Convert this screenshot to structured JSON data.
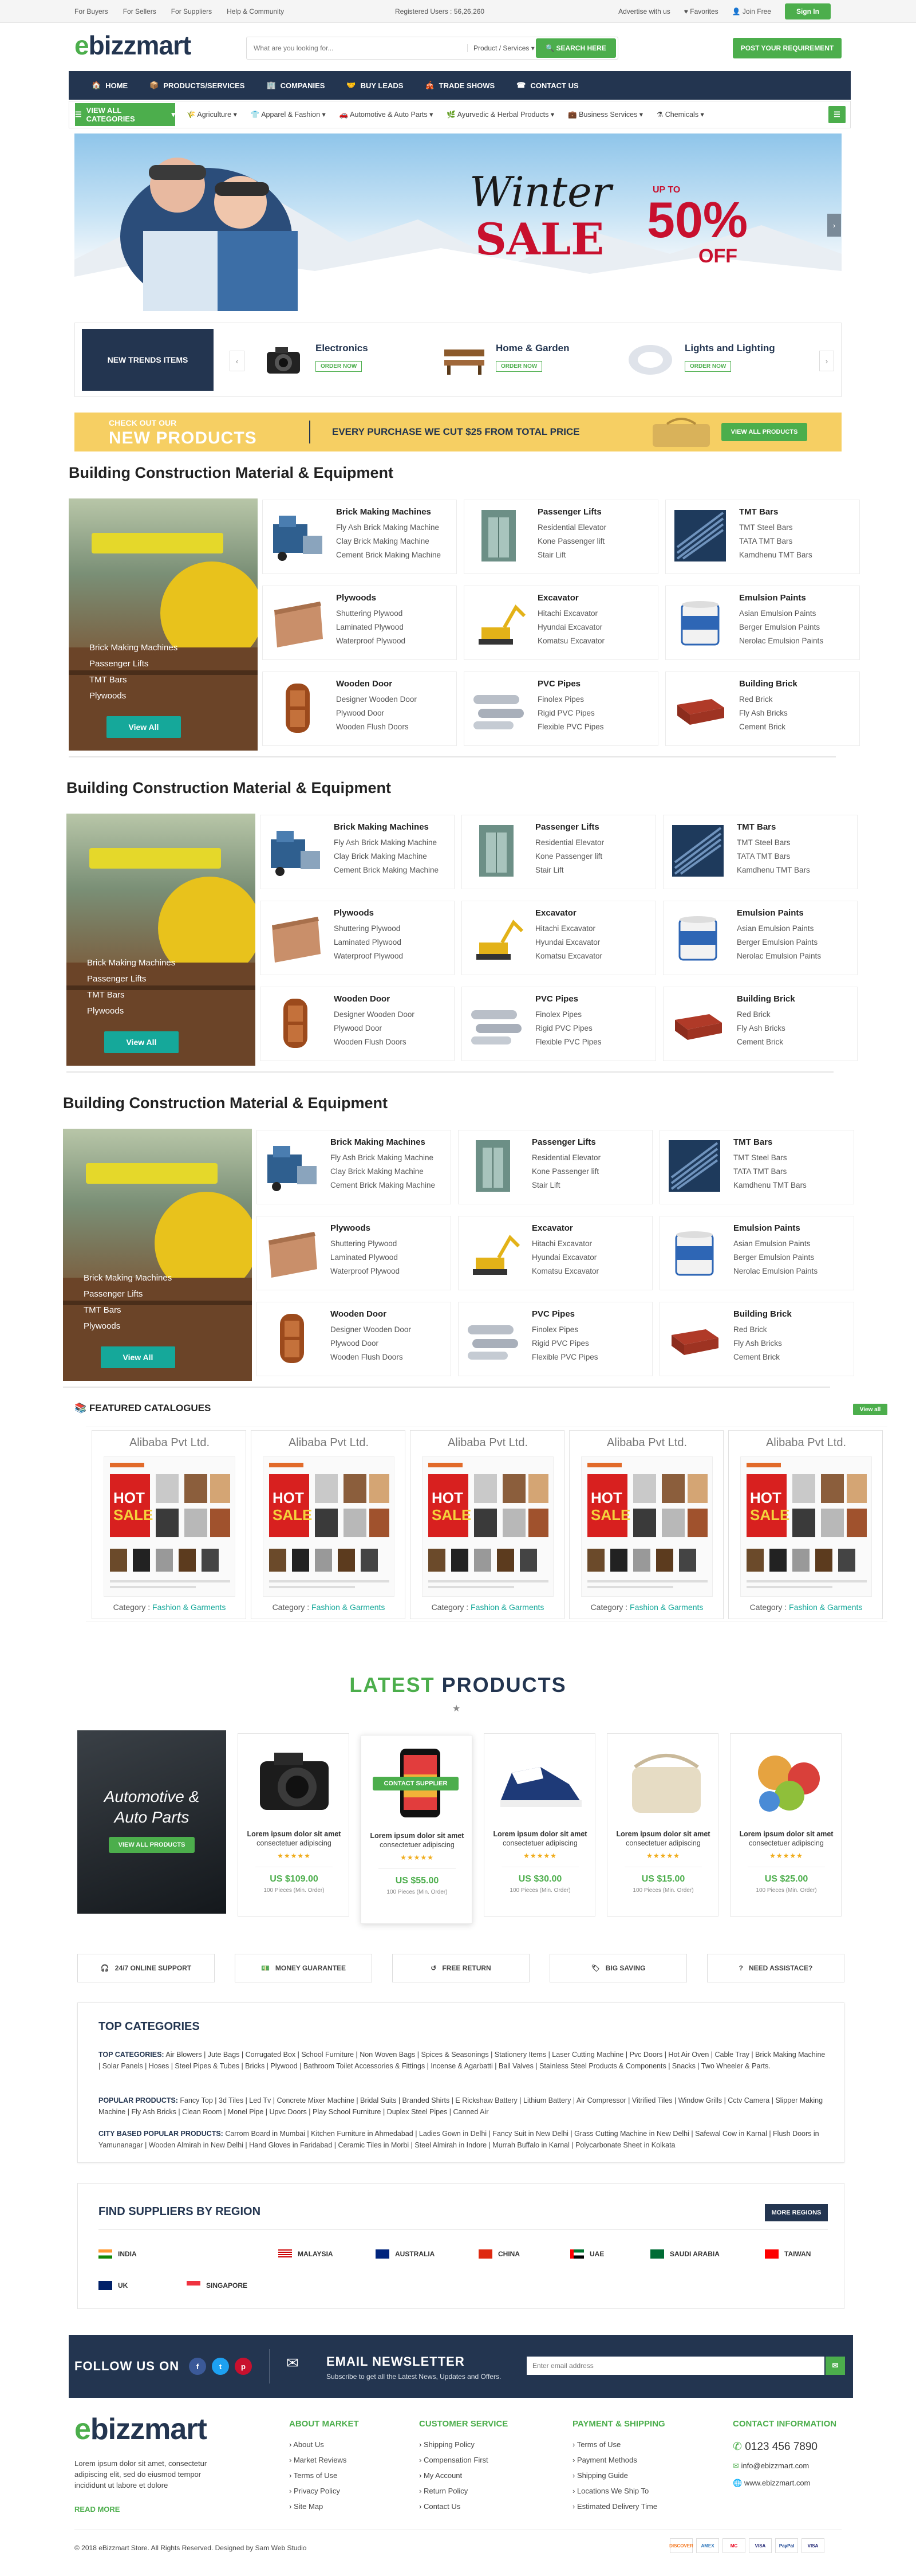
{
  "topbar": {
    "links": [
      "For Buyers",
      "For Sellers",
      "For Suppliers",
      "Help & Community"
    ],
    "registered": "Registered Users : 56,26,260",
    "advertise": "Advertise with us",
    "favorites": "Favorites",
    "join": "Join Free",
    "signin": "Sign In"
  },
  "brand": {
    "logo_e": "e",
    "logo_rest": "bizzmart"
  },
  "search": {
    "placeholder": "What are you looking for...",
    "select": "Product / Services",
    "button": "SEARCH HERE",
    "post": "POST YOUR REQUIREMENT"
  },
  "nav": [
    {
      "label": "HOME"
    },
    {
      "label": "PRODUCTS/SERVICES"
    },
    {
      "label": "COMPANIES"
    },
    {
      "label": "BUY LEADS"
    },
    {
      "label": "TRADE SHOWS"
    },
    {
      "label": "CONTACT US"
    }
  ],
  "categories": {
    "all": "VIEW ALL CATEGORIES",
    "items": [
      "Agriculture",
      "Apparel & Fashion",
      "Automotive & Auto Parts",
      "Ayurvedic & Herbal Products",
      "Business Services",
      "Chemicals"
    ]
  },
  "hero": {
    "winter": "Winter",
    "sale": "SALE",
    "upto": "UP TO",
    "pct": "50%",
    "off": "OFF"
  },
  "trends": {
    "label": "NEW TRENDS ITEMS",
    "items": [
      {
        "name": "Electronics",
        "btn": "ORDER NOW"
      },
      {
        "name": "Home & Garden",
        "btn": "ORDER NOW"
      },
      {
        "name": "Lights and Lighting",
        "btn": "ORDER NOW"
      }
    ]
  },
  "promo": {
    "small": "CHECK OUT OUR",
    "big": "NEW PRODUCTS",
    "mid": "EVERY PURCHASE WE CUT $25 FROM TOTAL PRICE",
    "btn": "VIEW ALL PRODUCTS"
  },
  "construction": {
    "title": "Building Construction Material & Equipment",
    "banner_items": [
      "Brick Making Machines",
      "Passenger Lifts",
      "TMT Bars",
      "Plywoods"
    ],
    "view_all": "View All",
    "cards": [
      {
        "title": "Brick Making Machines",
        "subs": [
          "Fly Ash Brick Making Machine",
          "Clay Brick Making Machine",
          "Cement Brick Making Machine"
        ]
      },
      {
        "title": "Passenger Lifts",
        "subs": [
          "Residential Elevator",
          "Kone Passenger lift",
          "Stair Lift"
        ]
      },
      {
        "title": "TMT Bars",
        "subs": [
          "TMT Steel Bars",
          "TATA TMT Bars",
          "Kamdhenu TMT Bars"
        ]
      },
      {
        "title": "Plywoods",
        "subs": [
          "Shuttering Plywood",
          "Laminated Plywood",
          "Waterproof Plywood"
        ]
      },
      {
        "title": "Excavator",
        "subs": [
          "Hitachi Excavator",
          "Hyundai Excavator",
          "Komatsu Excavator"
        ]
      },
      {
        "title": "Emulsion Paints",
        "subs": [
          "Asian Emulsion Paints",
          "Berger Emulsion Paints",
          "Nerolac Emulsion Paints"
        ]
      },
      {
        "title": "Wooden Door",
        "subs": [
          "Designer Wooden Door",
          "Plywood Door",
          "Wooden Flush Doors"
        ]
      },
      {
        "title": "PVC Pipes",
        "subs": [
          "Finolex Pipes",
          "Rigid PVC Pipes",
          "Flexible PVC Pipes"
        ]
      },
      {
        "title": "Building Brick",
        "subs": [
          "Red Brick",
          "Fly Ash Bricks",
          "Cement Brick"
        ]
      }
    ]
  },
  "catalogues": {
    "title": "FEATURED CATALOGUES",
    "view_all": "View all",
    "company": "Alibaba Pvt Ltd.",
    "category_label": "Category :",
    "category": "Fashion & Garments"
  },
  "latest": {
    "title_a": "LATEST",
    "title_b": "PRODUCTS",
    "banner_line1": "Automotive &",
    "banner_line2": "Auto Parts",
    "banner_btn": "VIEW ALL PRODUCTS",
    "desc1": "Lorem ipsum dolor sit amet",
    "desc2": "consectetuer adipiscing",
    "contact": "CONTACT SUPPLIER",
    "min": "100 Pieces (Min. Order)",
    "prices": [
      "US $109.00",
      "US $55.00",
      "US $30.00",
      "US $15.00",
      "US $25.00"
    ]
  },
  "services": [
    "24/7 ONLINE SUPPORT",
    "MONEY GUARANTEE",
    "FREE RETURN",
    "BIG SAVING",
    "NEED ASSISTACE?"
  ],
  "top_categories": {
    "title": "TOP CATEGORIES",
    "rows": [
      {
        "label": "TOP CATEGORIES:",
        "text": "Air Blowers | Jute Bags | Corrugated Box | School Furniture | Non Woven Bags | Spices & Seasonings | Stationery Items | Laser Cutting Machine | Pvc Doors | Hot Air Oven | Cable Tray | Brick Making Machine | Solar Panels | Hoses | Steel Pipes & Tubes | Bricks | Plywood | Bathroom Toilet Accessories & Fittings | Incense & Agarbatti | Ball Valves | Stainless Steel Products & Components | Snacks | Two Wheeler & Parts."
      },
      {
        "label": "POPULAR PRODUCTS:",
        "text": "Fancy Top | 3d Tiles | Led Tv | Concrete Mixer Machine | Bridal Suits | Branded Shirts | E Rickshaw Battery | Lithium Battery | Air Compressor | Vitrified Tiles | Window Grills | Cctv Camera | Slipper Making Machine | Fly Ash Bricks | Clean Room | Monel Pipe | Upvc Doors | Play School Furniture | Duplex Steel Pipes | Canned Air"
      },
      {
        "label": "CITY BASED POPULAR PRODUCTS:",
        "text": "Carrom Board in Mumbai | Kitchen Furniture in Ahmedabad | Ladies Gown in Delhi | Fancy Suit in New Delhi | Grass Cutting Machine in New Delhi | Safewal Cow in Karnal | Flush Doors in Yamunanagar | Wooden Almirah in New Delhi | Hand Gloves in Faridabad | Ceramic Tiles in Morbi | Steel Almirah in Indore | Murrah Buffalo in Karnal | Polycarbonate Sheet in Kolkata"
      }
    ]
  },
  "regions": {
    "title": "FIND SUPPLIERS BY REGION",
    "btn": "MORE REGIONS",
    "items": [
      "INDIA",
      "MALAYSIA",
      "AUSTRALIA",
      "CHINA",
      "UAE",
      "SAUDI ARABIA",
      "TAIWAN",
      "UK",
      "SINGAPORE"
    ]
  },
  "newsletter": {
    "follow": "FOLLOW US ON",
    "title": "EMAIL NEWSLETTER",
    "sub": "Subscribe to get all the Latest News, Updates and Offers.",
    "placeholder": "Enter email address"
  },
  "footer": {
    "about": "Lorem ipsum dolor sit amet, consectetur adipiscing elit, sed do eiusmod tempor incididunt ut labore et dolore",
    "read": "READ MORE",
    "cols": [
      {
        "title": "ABOUT MARKET",
        "items": [
          "About Us",
          "Market Reviews",
          "Terms of Use",
          "Privacy Policy",
          "Site Map"
        ]
      },
      {
        "title": "CUSTOMER SERVICE",
        "items": [
          "Shipping Policy",
          "Compensation First",
          "My Account",
          "Return Policy",
          "Contact Us"
        ]
      },
      {
        "title": "PAYMENT & SHIPPING",
        "items": [
          "Terms of Use",
          "Payment Methods",
          "Shipping Guide",
          "Locations We Ship To",
          "Estimated Delivery Time"
        ]
      }
    ],
    "contact_title": "CONTACT INFORMATION",
    "phone": "0123 456 7890",
    "email": "info@ebizzmart.com",
    "web": "www.ebizzmart.com",
    "copyright": "© 2018 eBizzmart Store. All Rights Reserved. Designed by Sam Web Studio",
    "payments": [
      "DISCOVER",
      "AMEX",
      "MC",
      "VISA",
      "PayPal",
      "VISA"
    ]
  },
  "colors": {
    "green": "#4cae4c",
    "navy": "#233550",
    "teal": "#15a89a",
    "red": "#c8102e"
  }
}
